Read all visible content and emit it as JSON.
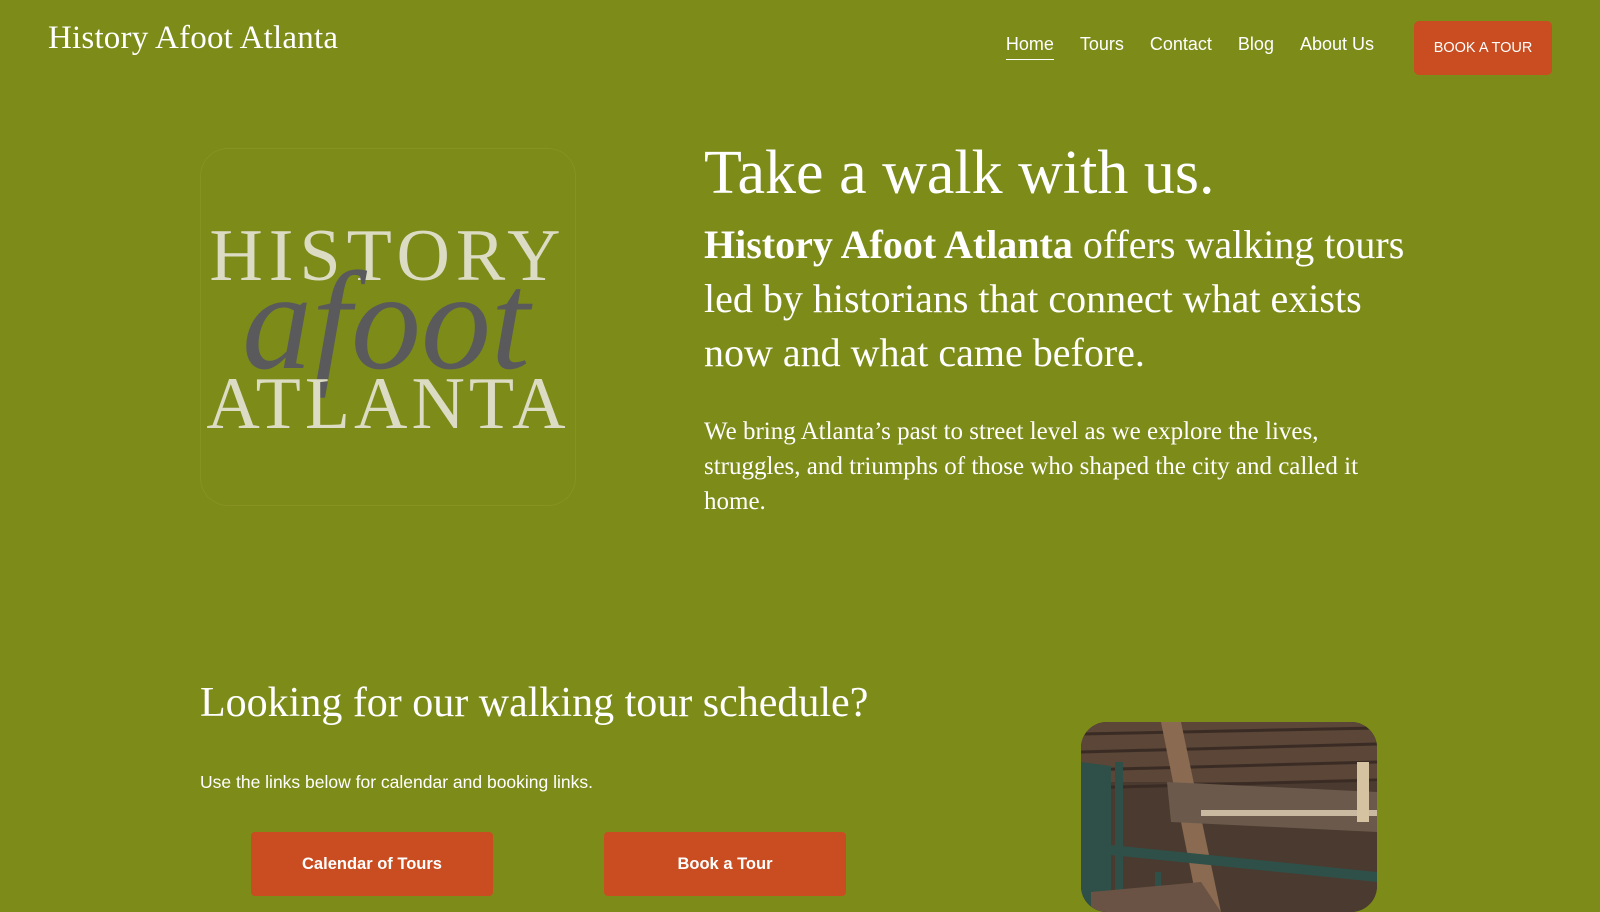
{
  "header": {
    "site_title": "History Afoot Atlanta",
    "nav": [
      {
        "label": "Home",
        "active": true
      },
      {
        "label": "Tours"
      },
      {
        "label": "Contact"
      },
      {
        "label": "Blog"
      },
      {
        "label": "About Us"
      }
    ],
    "cta_label": "BOOK A TOUR"
  },
  "logo": {
    "line1": "HISTORY",
    "line2": "afoot",
    "line3": "ATLANTA"
  },
  "hero": {
    "heading": "Take a walk with us.",
    "intro_bold": "History Afoot Atlanta",
    "intro_rest": " offers walking tours led by historians that connect what exists now and what came before.",
    "body": "We bring Atlanta’s past to street level as we explore the lives, struggles, and triumphs of those who shaped the city and called it home."
  },
  "schedule": {
    "heading": "Looking for our walking tour schedule?",
    "text": "Use the links below for calendar and booking links.",
    "calendar_button": "Calendar of Tours",
    "book_button": "Book a Tour"
  },
  "colors": {
    "background": "#7d8b19",
    "accent": "#c94d20",
    "logo_light": "#dcdcc4",
    "logo_dark": "#5a5a5c"
  }
}
